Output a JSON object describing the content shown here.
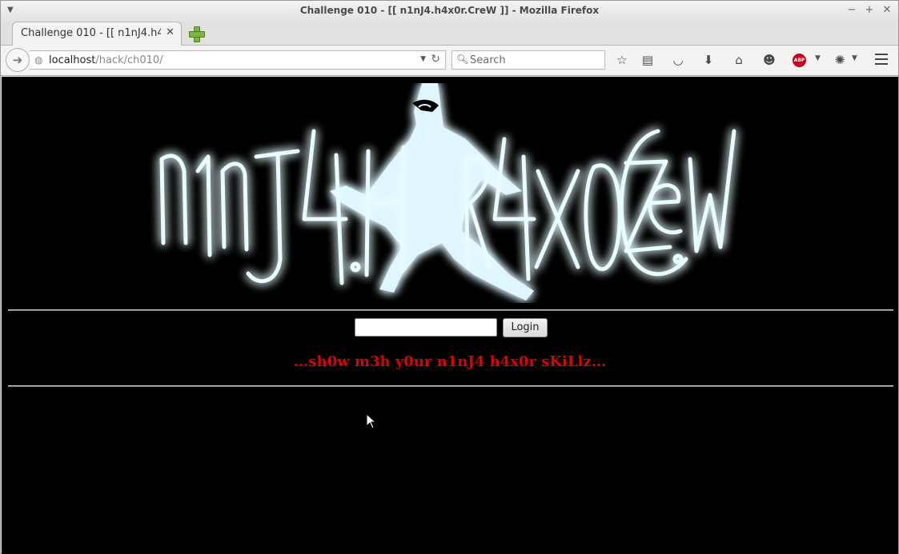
{
  "window": {
    "title": "Challenge 010 - [[ n1nJ4.h4x0r.CreW ]] - Mozilla Firefox",
    "controls": {
      "minimize": "−",
      "maximize": "+",
      "close": "✕"
    }
  },
  "tabs": [
    {
      "label": "Challenge 010 - [[ n1nJ4.h4x0r.CreW ]] - Mozilla Firefox",
      "close": "✕"
    }
  ],
  "navbar": {
    "url_host": "localhost",
    "url_path": "/hack/ch010/",
    "search_placeholder": "Search",
    "icons": [
      "back-icon",
      "globe-icon",
      "reload-icon",
      "search-icon",
      "bookmark-star-icon",
      "reading-list-icon",
      "pocket-icon",
      "download-icon",
      "home-icon",
      "hello-icon",
      "adblock-plus-icon",
      "extension-icon",
      "menu-icon"
    ]
  },
  "page": {
    "logo_text": "n1nJ4.H4X0RZ.CReW",
    "login_value": "",
    "login_button": "Login",
    "taunt": "...sh0w m3h y0ur n1nJ4 h4x0r sKiLlz...",
    "colors": {
      "background": "#000000",
      "taunt": "#e00000",
      "glow": "#37c9ff"
    }
  }
}
